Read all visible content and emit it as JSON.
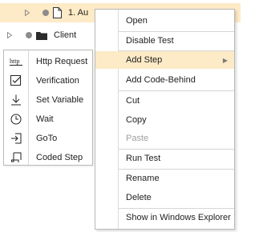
{
  "tree": {
    "items": [
      {
        "label": "1. Au",
        "icon": "document-icon"
      },
      {
        "label": "Client",
        "icon": "folder-icon"
      }
    ]
  },
  "submenu": {
    "items": [
      {
        "label": "Http Request",
        "icon": "http-icon"
      },
      {
        "label": "Verification",
        "icon": "checkbox-icon"
      },
      {
        "label": "Set Variable",
        "icon": "download-arrow-icon"
      },
      {
        "label": "Wait",
        "icon": "clock-icon"
      },
      {
        "label": "GoTo",
        "icon": "goto-arrow-icon"
      },
      {
        "label": "Coded Step",
        "icon": "scroll-icon"
      }
    ],
    "http_icon_text": "http"
  },
  "context_menu": {
    "items": [
      {
        "label": "Open"
      },
      {
        "label": "Disable Test"
      },
      {
        "label": "Add Step",
        "has_submenu": true,
        "highlighted": true
      },
      {
        "label": "Add Code-Behind"
      },
      {
        "label": "Cut"
      },
      {
        "label": "Copy"
      },
      {
        "label": "Paste",
        "disabled": true
      },
      {
        "label": "Run Test"
      },
      {
        "label": "Rename"
      },
      {
        "label": "Delete"
      },
      {
        "label": "Show in Windows Explorer"
      }
    ],
    "submenu_arrow": "▶"
  },
  "colors": {
    "highlight": "#fdeac6",
    "border": "#b9b9b9",
    "disabled_text": "#a0a0a0",
    "status_dot": "#8c8c8c"
  }
}
